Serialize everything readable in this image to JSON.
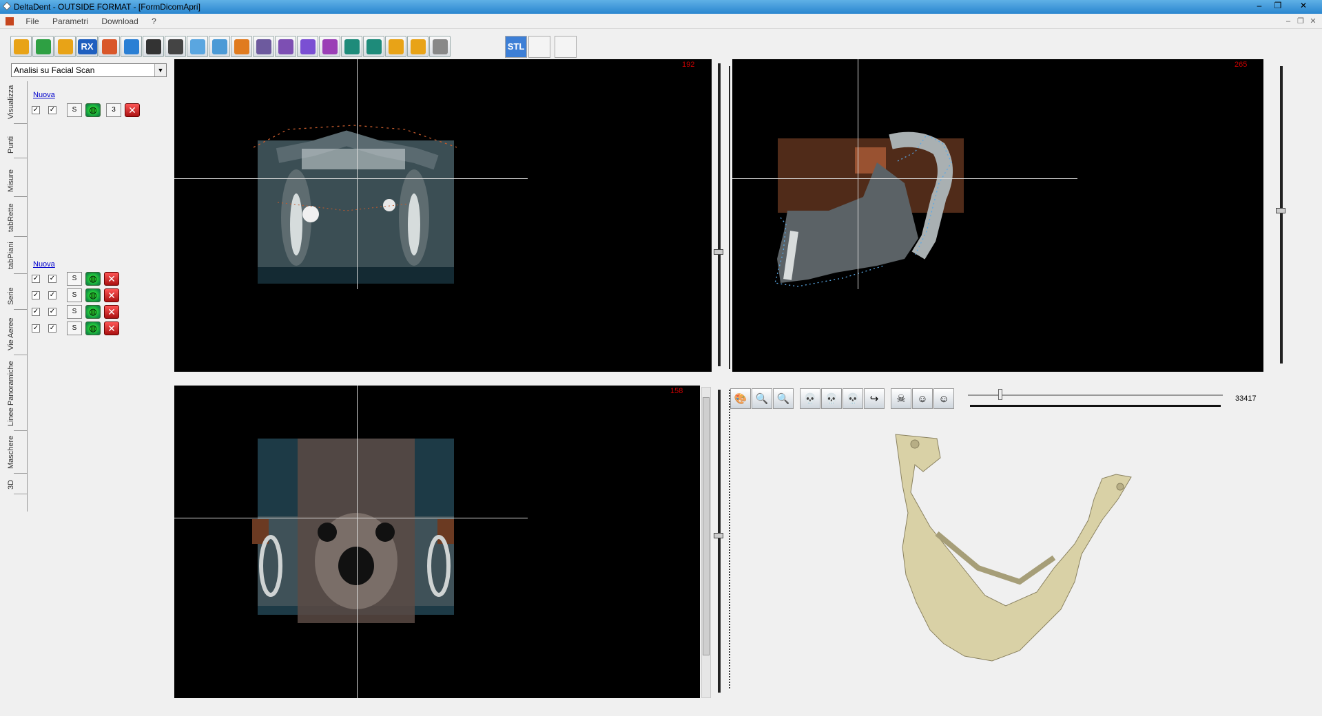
{
  "window": {
    "title": "DeltaDent - OUTSIDE FORMAT - [FormDicomApri]",
    "controls": [
      "–",
      "❐",
      "✕"
    ],
    "mdi_controls": [
      "–",
      "❐",
      "✕"
    ]
  },
  "menu": {
    "items": [
      "File",
      "Parametri",
      "Download",
      "?"
    ]
  },
  "toolbar": {
    "rx_label": "RX",
    "stl_label": "STL",
    "icons": [
      {
        "name": "open-folder-icon",
        "color": "#e8a317"
      },
      {
        "name": "confirm-check-icon",
        "color": "#2ea043"
      },
      {
        "name": "export-folder-icon",
        "color": "#e8a317"
      },
      {
        "name": "rx-icon",
        "color": "#1f5fbf"
      },
      {
        "name": "orthopanoramic-icon",
        "color": "#d9572a"
      },
      {
        "name": "crosshair-axes-icon",
        "color": "#2a7fd4"
      },
      {
        "name": "head-profile-dark-icon",
        "color": "#333333"
      },
      {
        "name": "head-profile-icon",
        "color": "#444444"
      },
      {
        "name": "airway-icon",
        "color": "#5aa6e0"
      },
      {
        "name": "measure-probe-icon",
        "color": "#4b9ad6"
      },
      {
        "name": "implant-icon",
        "color": "#e07b1f"
      },
      {
        "name": "skull-icon",
        "color": "#6d5a9e"
      },
      {
        "name": "grid-search-icon",
        "color": "#7d4fb3"
      },
      {
        "name": "arch-curve-icon",
        "color": "#7a4fd3"
      },
      {
        "name": "vertical-arrows-icon",
        "color": "#9b3fb6"
      },
      {
        "name": "printer-icon",
        "color": "#1e8b7a"
      },
      {
        "name": "printer-preview-icon",
        "color": "#1e8b7a"
      },
      {
        "name": "zoom-in-icon",
        "color": "#e8a317"
      },
      {
        "name": "zoom-out-icon",
        "color": "#e8a317"
      },
      {
        "name": "gray-square-icon",
        "color": "#888888"
      }
    ]
  },
  "left_panel": {
    "analysis_select": "Analisi su Facial Scan",
    "vertical_tabs": [
      "Visualizza",
      "Punti",
      "Misure",
      "tabRette",
      "tabPiani",
      "Serie",
      "Vie Aeree",
      "Linee Panoramiche",
      "Maschere",
      "3D"
    ],
    "group1": {
      "new_link": "Nuova",
      "rows": [
        {
          "s": "S",
          "num": "3"
        }
      ]
    },
    "group2": {
      "new_link": "Nuova",
      "rows": [
        {
          "s": "S"
        },
        {
          "s": "S"
        },
        {
          "s": "S"
        },
        {
          "s": "S"
        }
      ]
    }
  },
  "viewports": {
    "axial": {
      "slice": "192"
    },
    "sagittal": {
      "slice": "265"
    },
    "coronal": {
      "slice": "158"
    }
  },
  "view3d": {
    "value": "33417",
    "slider_fraction": 0.12,
    "tools": [
      "palette-icon",
      "zoom-out-3d-icon",
      "zoom-in-3d-icon",
      "skull-front-icon",
      "skull-top-icon",
      "skull-side-icon",
      "rotate-arrow-icon",
      "skull-dark-icon",
      "face-front-icon",
      "face-side-icon"
    ]
  }
}
